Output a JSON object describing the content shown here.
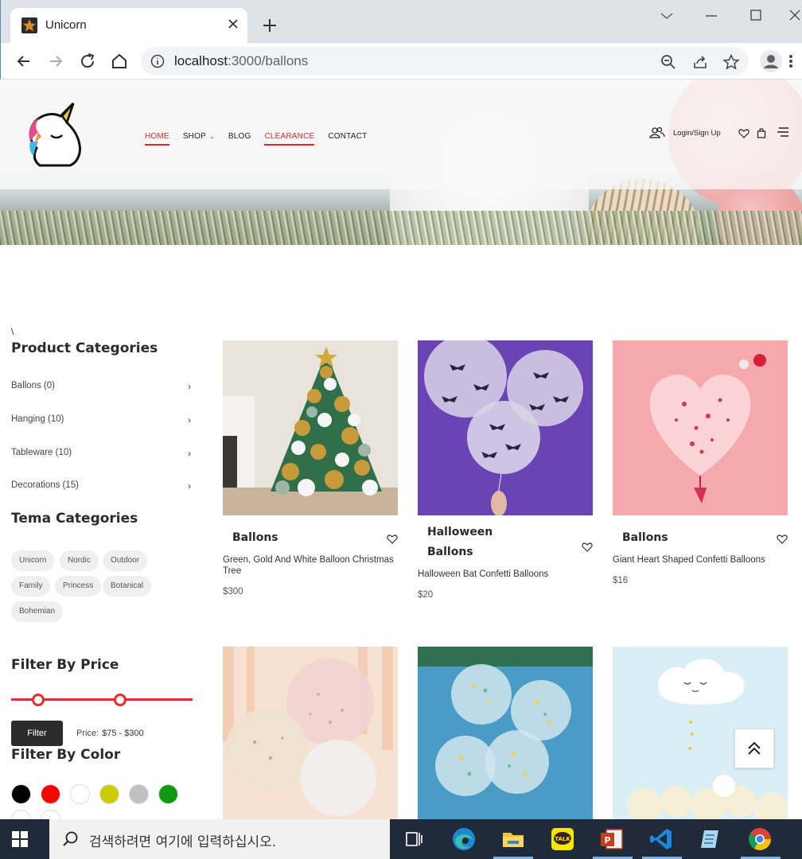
{
  "browser": {
    "tab_title": "Unicorn",
    "url_host": "localhost",
    "url_path": ":3000/ballons"
  },
  "site": {
    "nav": [
      {
        "label": "HOME",
        "active": true
      },
      {
        "label": "SHOP",
        "dropdown": true
      },
      {
        "label": "BLOG"
      },
      {
        "label": "CLEARANCE",
        "active": true
      },
      {
        "label": "CONTACT"
      }
    ],
    "login_label": "Login/Sign Up"
  },
  "sidebar": {
    "stray_text": "\\",
    "product_categories_title": "Product Categories",
    "categories": [
      {
        "label": "Ballons (0)"
      },
      {
        "label": "Hanging (10)"
      },
      {
        "label": "Tableware (10)"
      },
      {
        "label": "Decorations (15)"
      }
    ],
    "tema_title": "Tema Categories",
    "tags": [
      "Unicorn",
      "Nordic",
      "Outdoor",
      "Family",
      "Princess",
      "Botanical",
      "Bohemian"
    ],
    "price_title": "Filter By Price",
    "price_slider": {
      "min_fraction": 0.15,
      "max_fraction": 0.6
    },
    "filter_button": "Filter",
    "price_label": "Price:",
    "price_range": "$75 - $300",
    "color_title": "Filter By Color",
    "colors": [
      "#000000",
      "#ff0000",
      "#ffffff",
      "#cccc00",
      "#c0c0c0",
      "#119911",
      "#ffffff",
      "#ffffff"
    ]
  },
  "products": [
    {
      "title": "Ballons",
      "name": "Green, Gold And White Balloon Christmas Tree",
      "price": "$300"
    },
    {
      "title": "Halloween Ballons",
      "name": "Halloween Bat Confetti Balloons",
      "price": "$20"
    },
    {
      "title": "Ballons",
      "name": "Giant Heart Shaped Confetti Balloons",
      "price": "$16"
    }
  ],
  "taskbar": {
    "search_placeholder": "검색하려면 여기에 입력하십시오."
  }
}
